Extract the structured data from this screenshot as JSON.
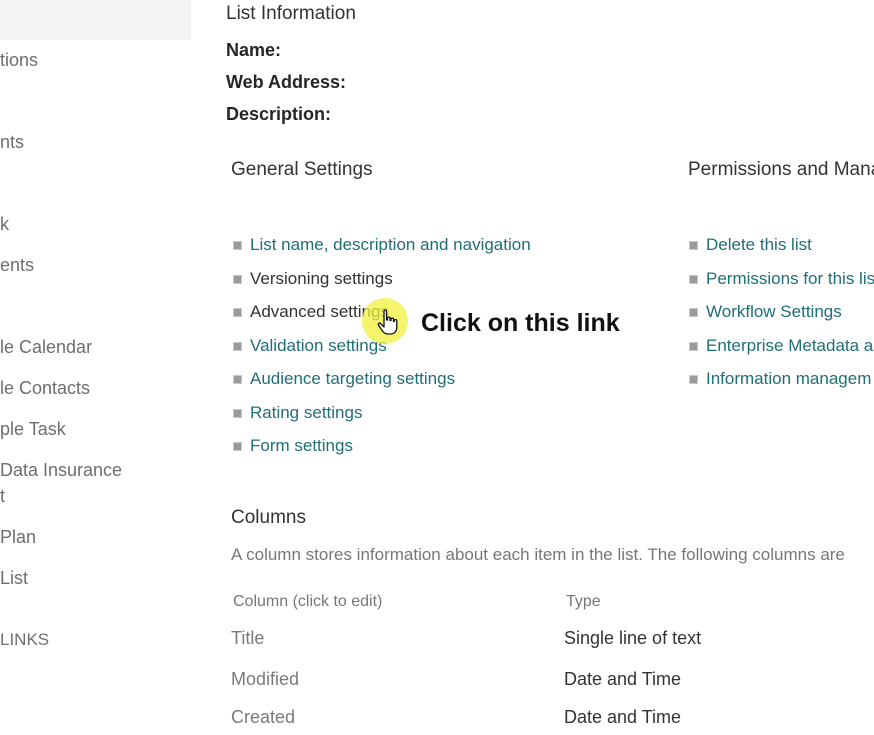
{
  "leftnav": {
    "items": [
      {
        "label": "tions",
        "top": 0
      },
      {
        "label": "nts"
      },
      {
        "label": "k"
      },
      {
        "label": "ents"
      },
      {
        "label": "le Calendar"
      },
      {
        "label": "le Contacts"
      },
      {
        "label": "ple Task"
      },
      {
        "label": "Data Insurance"
      },
      {
        "label": "t"
      },
      {
        "label": "Plan"
      },
      {
        "label": "List"
      },
      {
        "label": "LINKS"
      }
    ]
  },
  "list_info": {
    "title": "List Information",
    "name_label": "Name:",
    "web_address_label": "Web Address:",
    "description_label": "Description:"
  },
  "general_settings": {
    "title": "General Settings",
    "links": [
      "List name, description and navigation",
      "Versioning settings",
      "Advanced settings",
      "Validation settings",
      "Audience targeting settings",
      "Rating settings",
      "Form settings"
    ]
  },
  "permissions": {
    "title": "Permissions and Mana",
    "links": [
      "Delete this list",
      "Permissions for this lis",
      "Workflow Settings",
      "Enterprise Metadata a",
      "Information managem"
    ]
  },
  "columns": {
    "title": "Columns",
    "description": "A column stores information about each item in the list. The following columns are",
    "header_column": "Column (click to edit)",
    "header_type": "Type",
    "rows": [
      {
        "name": "Title",
        "type": "Single line of text"
      },
      {
        "name": "Modified",
        "type": "Date and Time"
      },
      {
        "name": "Created",
        "type": "Date and Time"
      }
    ]
  },
  "overlay": {
    "callout": "Click on this link",
    "icon": "hand-pointer-icon",
    "highlight_color": "#f0f03c"
  }
}
